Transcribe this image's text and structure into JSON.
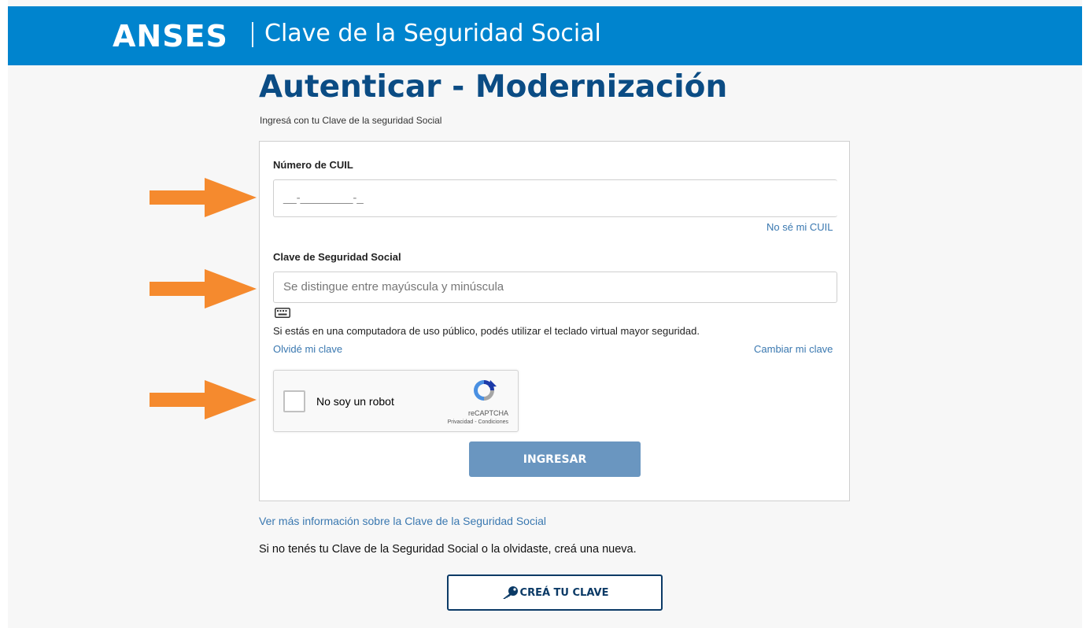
{
  "header": {
    "brand": "ANSES",
    "subtitle": "Clave de la Seguridad Social"
  },
  "page": {
    "title": "Autenticar - Modernización",
    "intro": "Ingresá con tu Clave de la seguridad Social"
  },
  "form": {
    "cuil_label": "Número de CUIL",
    "cuil_value": "__-________-_",
    "forgot_cuil": "No sé mi CUIL",
    "password_label": "Clave de Seguridad Social",
    "password_placeholder": "Se distingue entre mayúscula y minúscula",
    "keyboard_hint": "Si estás en una computadora de uso público, podés utilizar el teclado virtual mayor seguridad.",
    "forgot_password": "Olvidé mi clave",
    "change_password": "Cambiar mi clave",
    "submit_label": "INGRESAR"
  },
  "recaptcha": {
    "label": "No soy un robot",
    "brand": "reCAPTCHA",
    "legal": "Privacidad - Condiciones"
  },
  "footer": {
    "more_info": "Ver más información sobre la Clave de la Seguridad Social",
    "no_key_text": "Si no tenés tu Clave de la Seguridad Social o la olvidaste, creá una nueva.",
    "create_label": "CREÁ TU CLAVE"
  },
  "icons": {
    "keyboard": "keyboard-icon",
    "key": "key-icon",
    "recaptcha": "recaptcha-logo-icon",
    "arrow": "arrow-right-icon"
  },
  "colors": {
    "header_bg": "#0084ce",
    "title": "#0b4c84",
    "link": "#3a78b0",
    "primary_button": "#6a96c0",
    "outline_button": "#0b3a66",
    "annotation_arrow": "#f58a2e"
  }
}
